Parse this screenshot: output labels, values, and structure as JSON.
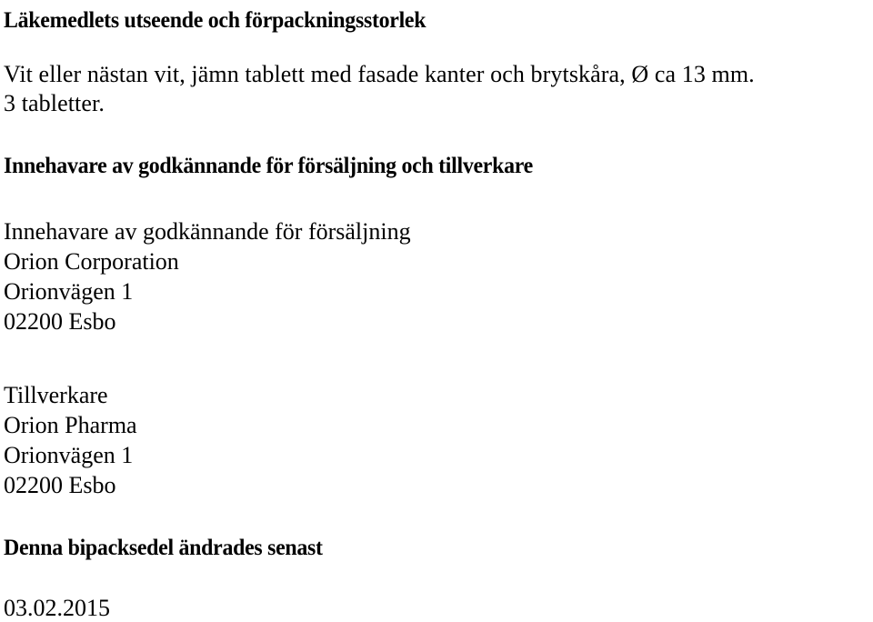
{
  "document": {
    "language": "sv",
    "text_color": "#000000",
    "background_color": "#ffffff",
    "sections": {
      "appearance": {
        "heading": "Läkemedlets utseende och förpackningsstorlek",
        "body_line_1": "Vit eller nästan vit, jämn tablett med fasade kanter och brytskåra, Ø ca 13 mm.",
        "body_line_2": "3 tabletter."
      },
      "marketing_authorisation": {
        "heading": "Innehavare av godkännande för försäljning och tillverkare",
        "holder": {
          "label": "Innehavare av godkännande för försäljning",
          "company": "Orion Corporation",
          "street": "Orionvägen 1",
          "postal_city": "02200 Esbo"
        },
        "manufacturer": {
          "label": "Tillverkare",
          "company": "Orion Pharma",
          "street": "Orionvägen 1",
          "postal_city": "02200 Esbo"
        }
      },
      "revision": {
        "heading": "Denna bipacksedel ändrades senast",
        "date": "03.02.2015"
      }
    }
  }
}
